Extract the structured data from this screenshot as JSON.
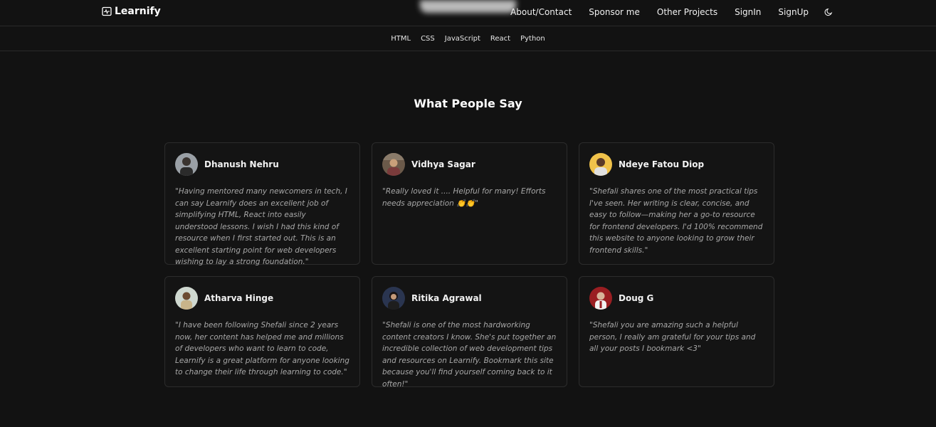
{
  "brand": {
    "name": "Learnify",
    "icon": "activity-icon"
  },
  "nav": {
    "links": [
      "About/Contact",
      "Sponsor me",
      "Other Projects",
      "SignIn",
      "SignUp"
    ],
    "theme_icon": "moon-icon"
  },
  "subnav": [
    "HTML",
    "CSS",
    "JavaScript",
    "React",
    "Python"
  ],
  "section": {
    "title": "What People Say"
  },
  "testimonials": [
    {
      "name": "Dhanush Nehru",
      "quote": "\"Having mentored many newcomers in tech, I can say Learnify does an excellent job of simplifying HTML, React into easily understood lessons. I wish I had this kind of resource when I first started out. This is an excellent starting point for web developers wishing to lay a strong foundation.\""
    },
    {
      "name": "Vidhya Sagar",
      "quote": "\"Really loved it .... Helpful for many! Efforts needs appreciation 👏👏\""
    },
    {
      "name": "Ndeye Fatou Diop",
      "quote": "\"Shefali shares one of the most practical tips I've seen. Her writing is clear, concise, and easy to follow—making her a go-to resource for frontend developers. I'd 100% recommend this website to anyone looking to grow their frontend skills.\""
    },
    {
      "name": "Atharva Hinge",
      "quote": "\"I have been following Shefali since 2 years now, her content has helped me and millions of developers who want to learn to code, Learnify is a great platform for anyone looking to change their life through learning to code.\""
    },
    {
      "name": "Ritika Agrawal",
      "quote": "\"Shefali is one of the most hardworking content creators I know. She's put together an incredible collection of web development tips and resources on Learnify. Bookmark this site because you'll find yourself coming back to it often!\""
    },
    {
      "name": "Doug G",
      "quote": "\"Shefali you are amazing such a helpful person, I really am grateful for your tips and all your posts I bookmark <3\""
    }
  ],
  "colors": {
    "background": "#121212",
    "card_border": "#2c2c2c",
    "quote_text": "#a8a8a8"
  }
}
